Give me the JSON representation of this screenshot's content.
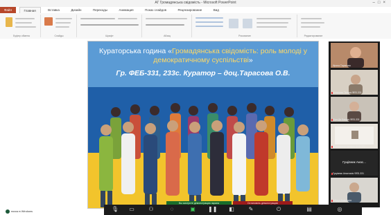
{
  "window": {
    "title": "АГ Громадянська свідомість - Microsoft PowerPoint"
  },
  "ribbon": {
    "tabs": [
      "Файл",
      "Главная",
      "Вставка",
      "Дизайн",
      "Переходы",
      "Анимация",
      "Показ слайдов",
      "Рецензирование",
      "Вид"
    ],
    "groups": [
      "Буфер обмена",
      "Слайды",
      "Шрифт",
      "Абзац",
      "Рисование",
      "Редактирование"
    ]
  },
  "slide": {
    "title_pre": "Кураторська година «",
    "title_highlight": "Громадянська свідомість: роль молоді у демократичному суспільстві",
    "title_post": "»",
    "subtitle": "Гр. ФЕБ-331, 233с. Куратор – доц.Тарасова О.В."
  },
  "participants": [
    {
      "name": "Ирина Тарасова"
    },
    {
      "name": "Копилова Тетяна ФЕБ-331"
    },
    {
      "name": "Сіра Дв Бакуля ФЕБ-331"
    },
    {
      "name": "Шевчишина Валерія ФЕБ-331"
    },
    {
      "name": "Гущівник Анас...",
      "sub": "Гущівник Анастасія ФЕБ-331"
    },
    {
      "name": "Гайдук Анастасія"
    }
  ],
  "share_bar": {
    "viewing": "Вы смотрите демонстрацию экрана",
    "stop": "Остановить демонстрацию"
  },
  "taskbar": {
    "search_placeholder": "поиск в Windows"
  },
  "colors": {
    "banner": "#5b9bd5",
    "highlight": "#ffd966",
    "file_tab": "#b7472a",
    "flag_blue": "#1f5fa8",
    "flag_yellow": "#f2c42c"
  }
}
